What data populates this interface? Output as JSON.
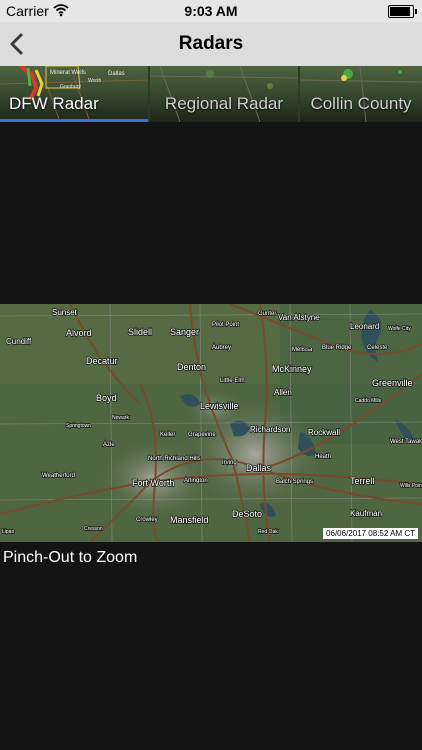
{
  "status": {
    "carrier": "Carrier",
    "time": "9:03 AM"
  },
  "nav": {
    "title": "Radars"
  },
  "tabs": [
    {
      "label": "DFW Radar",
      "active": true
    },
    {
      "label": "Regional Radar",
      "active": false
    },
    {
      "label": "Collin County",
      "active": false
    }
  ],
  "tab_thumb_labels": [
    "Mineral Wells",
    "Dallas",
    "Granbury",
    "Worth"
  ],
  "map": {
    "timestamp": "06/06/2017 08:52 AM CT",
    "cities": [
      "Sunset",
      "Alvord",
      "Slidell",
      "Sanger",
      "Pilot Point",
      "Gunter",
      "Van Alstyne",
      "Leonard",
      "Wolfe City",
      "Cundiff",
      "Decatur",
      "Aubrey",
      "Melissa",
      "Blue Ridge",
      "Celeste",
      "Denton",
      "McKinney",
      "Greenville",
      "Little Elm",
      "Allen",
      "Boyd",
      "Caddo Mills",
      "Lewisville",
      "Newark",
      "Springtown",
      "Keller",
      "Grapevine",
      "Richardson",
      "Rockwall",
      "Azle",
      "Heath",
      "West Tawakoni",
      "North Richland Hills",
      "Irving",
      "Dallas",
      "Weatherford",
      "Fort Worth",
      "Arlington",
      "Terrell",
      "Balch Springs",
      "Wills Point",
      "Crowley",
      "Mansfield",
      "DeSoto",
      "Kaufman",
      "Lipan",
      "Cresson",
      "Red Oak"
    ]
  },
  "hint": "Pinch-Out to Zoom",
  "icons": {
    "back": "back-chevron-icon",
    "wifi": "wifi-icon",
    "battery": "battery-icon"
  },
  "colors": {
    "accent": "#3b6fd6",
    "background": "#141414"
  }
}
